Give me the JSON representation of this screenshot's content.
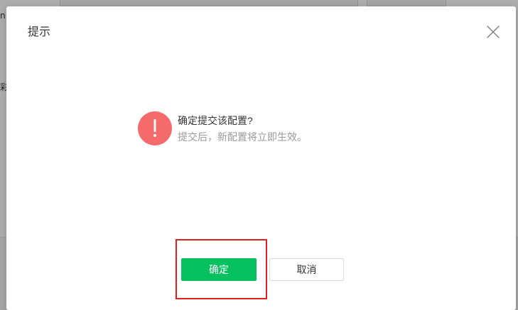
{
  "background": {
    "glyph_top": "n",
    "glyph_middle": "彩"
  },
  "dialog": {
    "title": "提示",
    "close_icon": "close-icon",
    "message": {
      "icon": "exclamation-icon",
      "primary": "确定提交该配置?",
      "secondary": "提交后，新配置将立即生效。"
    },
    "buttons": {
      "confirm_label": "确定",
      "cancel_label": "取消"
    }
  },
  "colors": {
    "primary": "#07c160",
    "warning": "#f56a6a",
    "highlight": "#e02020"
  }
}
